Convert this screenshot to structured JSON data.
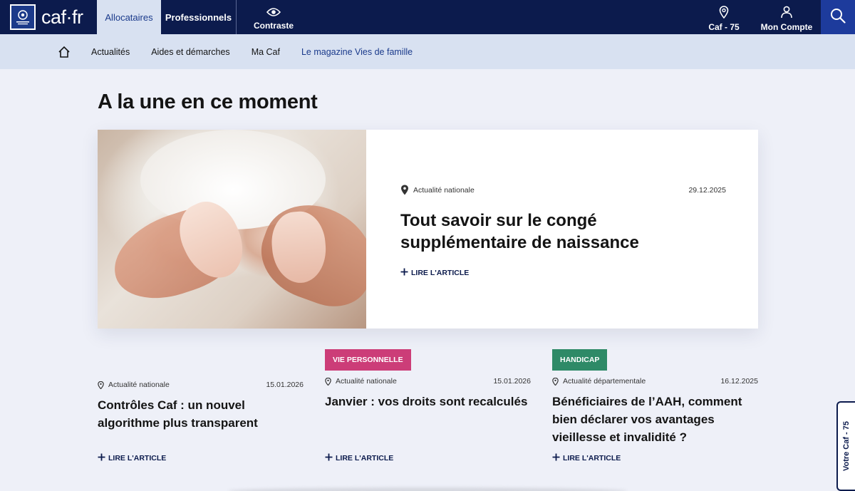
{
  "header": {
    "logo_text": "caf·fr",
    "tab_allocataires": "Allocataires",
    "tab_professionnels": "Professionnels",
    "contrast_label": "Contraste",
    "caf_location": "Caf - 75",
    "account_label": "Mon Compte",
    "icons": [
      "eye-icon",
      "location-pin-icon",
      "user-icon",
      "search-icon"
    ]
  },
  "subnav": {
    "items": [
      "Actualités",
      "Aides et démarches",
      "Ma Caf",
      "Le magazine Vies de famille"
    ]
  },
  "main": {
    "title": "A la une en ce moment",
    "hero": {
      "scope": "Actualité nationale",
      "date": "29.12.2025",
      "title": "Tout savoir sur le congé supplémentaire de naissance",
      "read_more": "LIRE L'ARTICLE"
    },
    "cards": [
      {
        "badge": "",
        "scope": "Actualité nationale",
        "date": "15.01.2026",
        "title": "Contrôles Caf : un nouvel algorithme plus transparent",
        "read_more": "LIRE L'ARTICLE"
      },
      {
        "badge": "VIE PERSONNELLE",
        "scope": "Actualité nationale",
        "date": "15.01.2026",
        "title": "Janvier : vos droits sont recalculés",
        "read_more": "LIRE L'ARTICLE"
      },
      {
        "badge": "HANDICAP",
        "scope": "Actualité départementale",
        "date": "16.12.2025",
        "title": "Bénéficiaires de l’AAH, comment bien déclarer vos avantages vieillesse et invalidité ?",
        "read_more": "LIRE L'ARTICLE"
      }
    ]
  },
  "side_tab": "Votre Caf - 75",
  "colors": {
    "header_bg": "#0c1b4d",
    "subnav_bg": "#d8e1f1",
    "page_bg": "#eef0f8",
    "badge_vie": "#cc3d78",
    "badge_handicap": "#2e8a67"
  }
}
